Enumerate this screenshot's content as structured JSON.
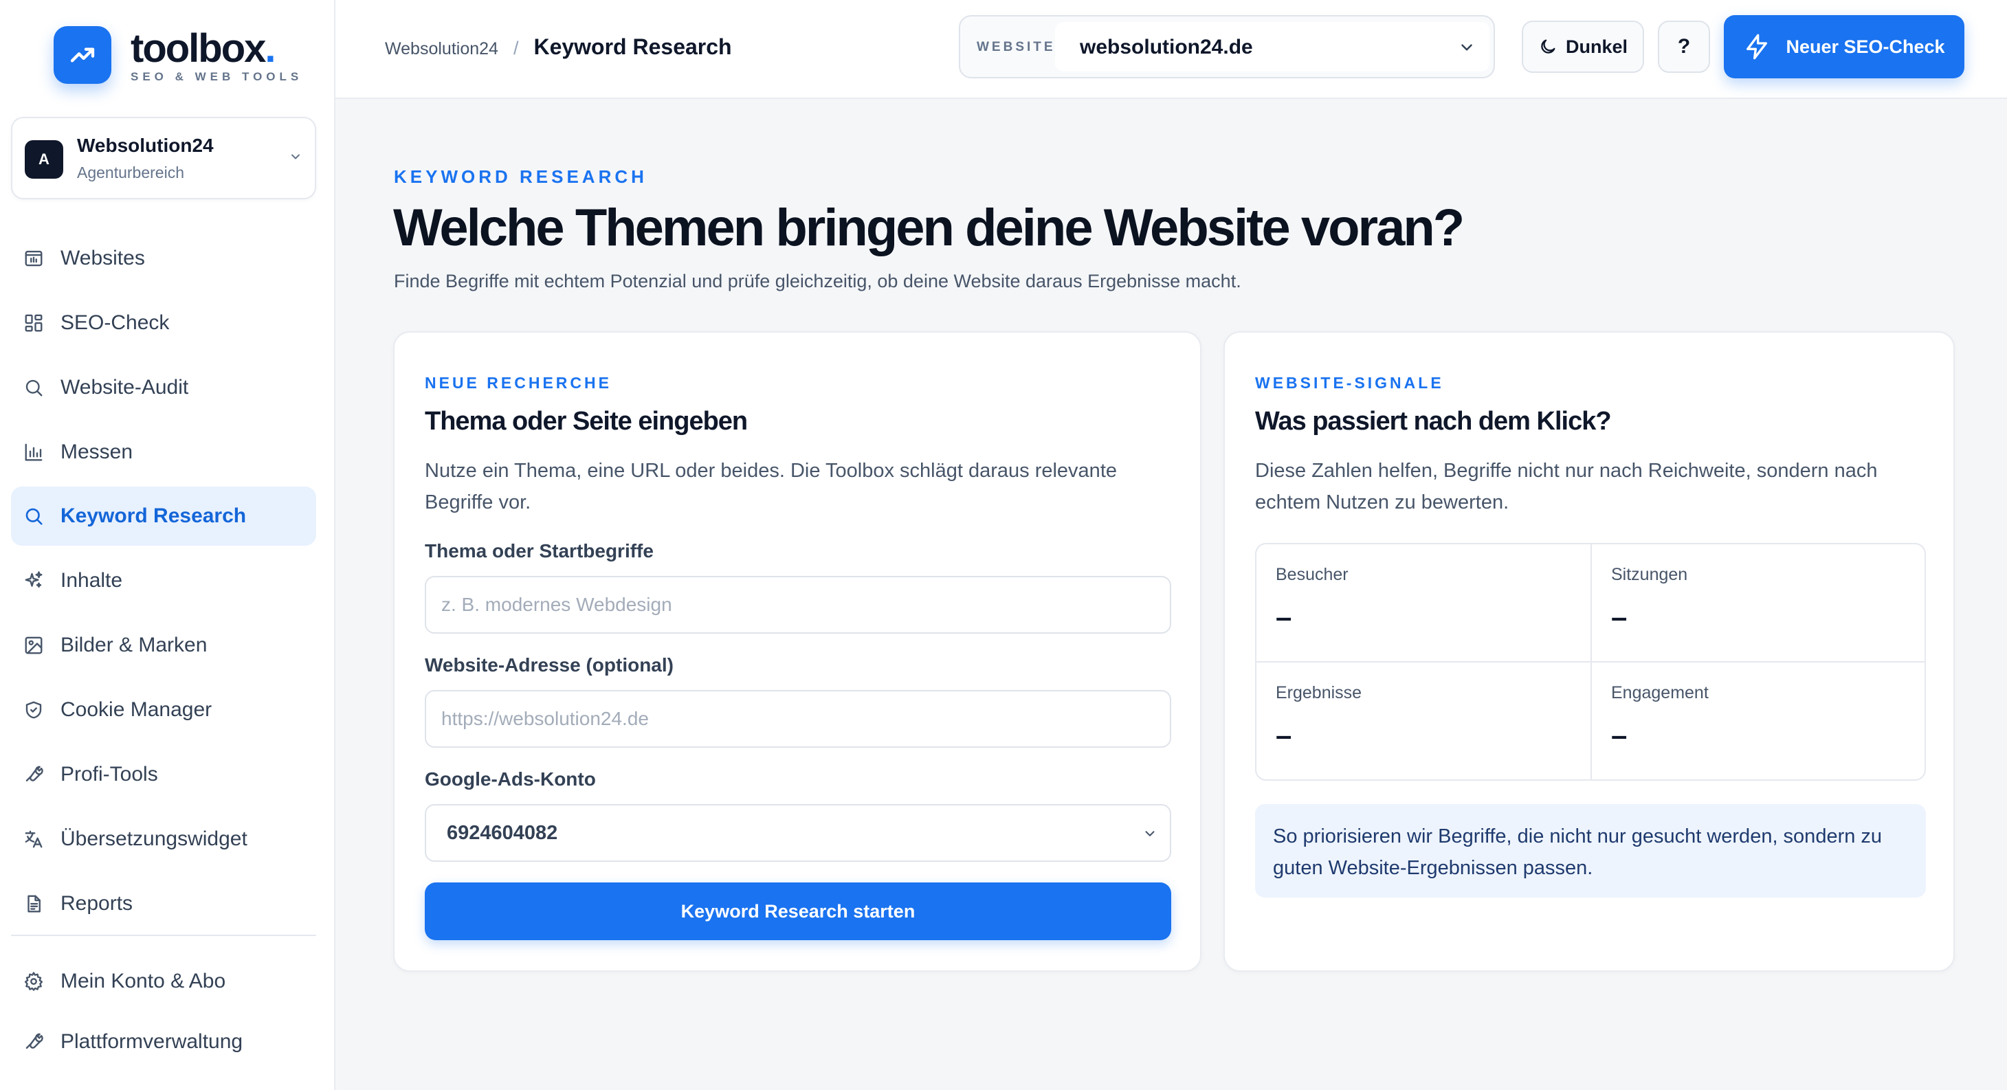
{
  "brand": {
    "name": "toolbox",
    "dot": ".",
    "tagline": "SEO & WEB TOOLS"
  },
  "account": {
    "initial": "A",
    "name": "Websolution24",
    "subtitle": "Agenturbereich"
  },
  "nav": {
    "items": [
      {
        "label": "Websites",
        "icon": "browser-icon"
      },
      {
        "label": "SEO-Check",
        "icon": "grid-icon"
      },
      {
        "label": "Website-Audit",
        "icon": "search-icon"
      },
      {
        "label": "Messen",
        "icon": "bar-chart-icon"
      },
      {
        "label": "Keyword Research",
        "icon": "search-icon"
      },
      {
        "label": "Inhalte",
        "icon": "sparkles-icon"
      },
      {
        "label": "Bilder & Marken",
        "icon": "image-icon"
      },
      {
        "label": "Cookie Manager",
        "icon": "shield-icon"
      },
      {
        "label": "Profi-Tools",
        "icon": "wrench-icon"
      },
      {
        "label": "Übersetzungswidget",
        "icon": "translate-icon"
      },
      {
        "label": "Reports",
        "icon": "document-icon"
      },
      {
        "label": "Mein Konto & Abo",
        "icon": "gear-icon"
      },
      {
        "label": "Plattformverwaltung",
        "icon": "wrench-icon"
      }
    ],
    "active": "Keyword Research"
  },
  "topbar": {
    "breadcrumb_parent": "Websolution24",
    "breadcrumb_sep": "/",
    "breadcrumb_current": "Keyword Research",
    "website_label": "WEBSITE",
    "website_value": "websolution24.de",
    "dark_label": "Dunkel",
    "help_label": "?",
    "new_check_label": "Neuer SEO-Check"
  },
  "hero": {
    "eyebrow": "KEYWORD RESEARCH",
    "title": "Welche Themen bringen deine Website voran?",
    "subtitle": "Finde Begriffe mit echtem Potenzial und prüfe gleichzeitig, ob deine Website daraus Ergebnisse macht."
  },
  "research": {
    "eyebrow": "NEUE RECHERCHE",
    "title": "Thema oder Seite eingeben",
    "description": "Nutze ein Thema, eine URL oder beides. Die Toolbox schlägt daraus relevante Begriffe vor.",
    "topic_label": "Thema oder Startbegriffe",
    "topic_placeholder": "z. B. modernes Webdesign",
    "url_label": "Website-Adresse (optional)",
    "url_placeholder": "https://websolution24.de",
    "ads_label": "Google-Ads-Konto",
    "ads_value": "6924604082",
    "submit_label": "Keyword Research starten"
  },
  "signals": {
    "eyebrow": "WEBSITE-SIGNALE",
    "title": "Was passiert nach dem Klick?",
    "description": "Diese Zahlen helfen, Begriffe nicht nur nach Reichweite, sondern nach echtem Nutzen zu bewerten.",
    "metrics": [
      {
        "label": "Besucher",
        "value": "–"
      },
      {
        "label": "Sitzungen",
        "value": "–"
      },
      {
        "label": "Ergebnisse",
        "value": "–"
      },
      {
        "label": "Engagement",
        "value": "–"
      }
    ],
    "info": "So priorisieren wir Begriffe, die nicht nur gesucht werden, sondern zu guten Website-Ergebnissen passen."
  },
  "colors": {
    "accent": "#1a73f0",
    "accent_soft": "#e8f1fe",
    "text": "#0f172a",
    "muted": "#475569"
  }
}
